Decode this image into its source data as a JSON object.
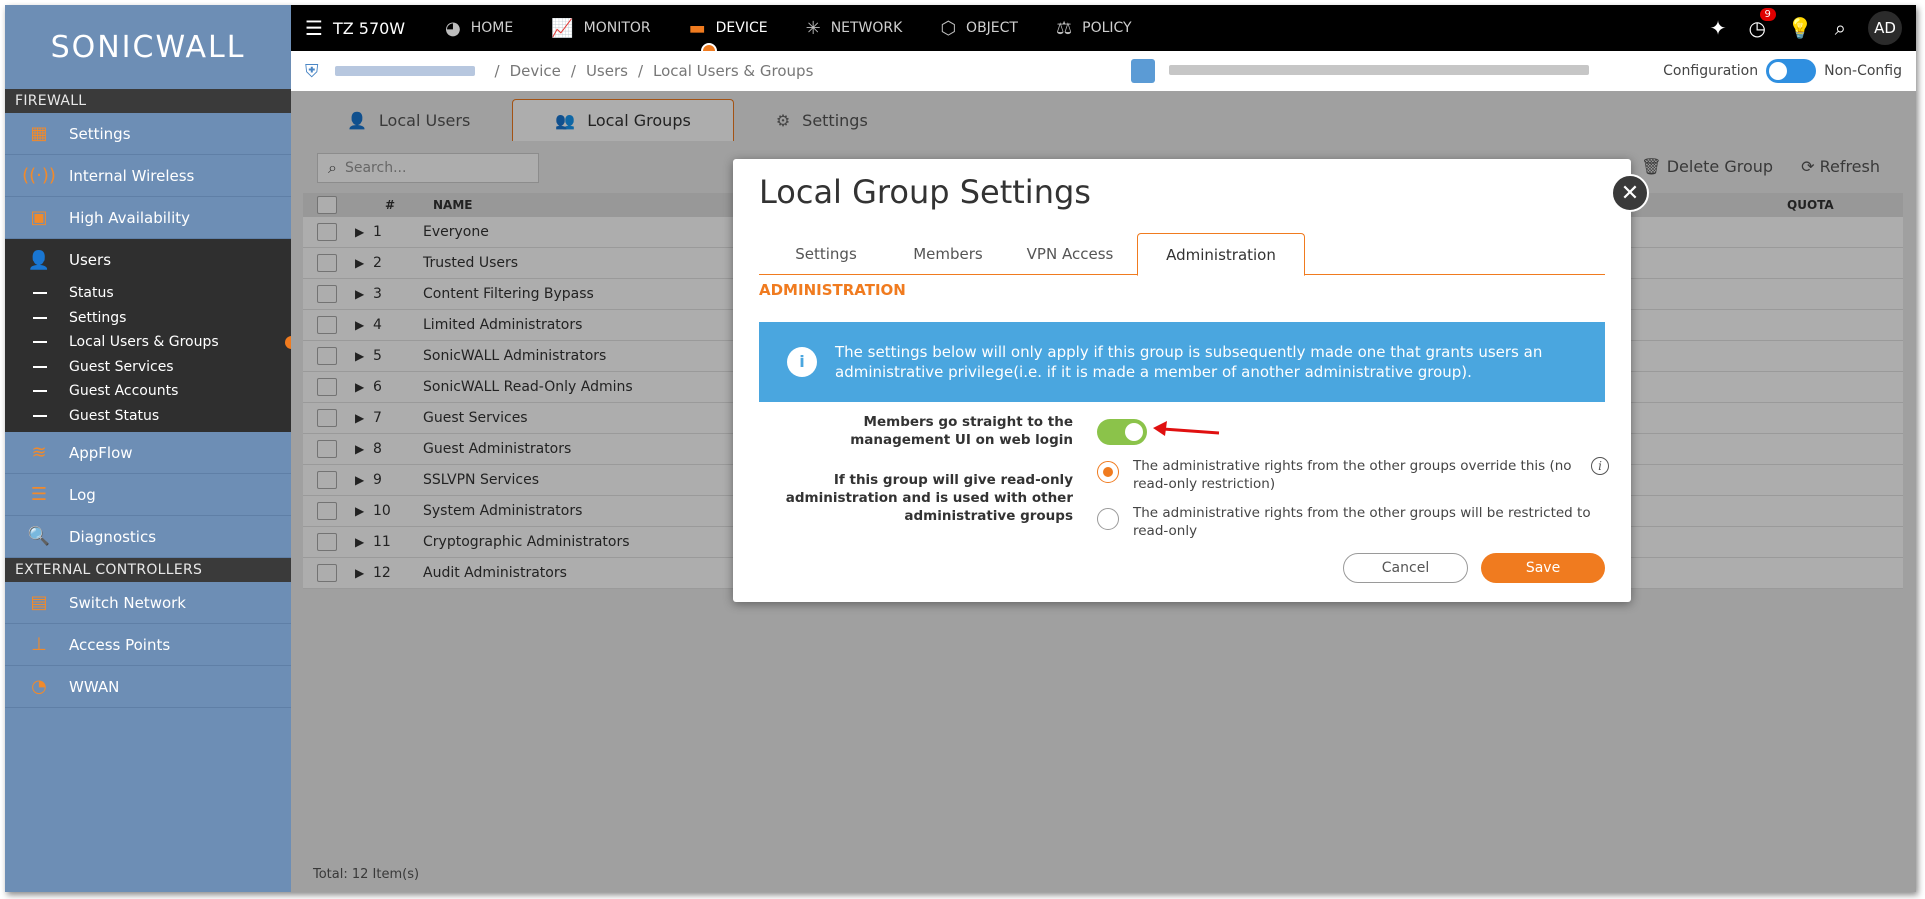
{
  "brand": {
    "logo_text": "SONICWALL"
  },
  "sidebar": {
    "sections": [
      {
        "title": "FIREWALL"
      },
      {
        "title": "EXTERNAL CONTROLLERS"
      }
    ],
    "items": [
      {
        "label": "Settings"
      },
      {
        "label": "Internal Wireless"
      },
      {
        "label": "High Availability"
      },
      {
        "label": "Users"
      },
      {
        "label": "AppFlow"
      },
      {
        "label": "Log"
      },
      {
        "label": "Diagnostics"
      },
      {
        "label": "Switch Network"
      },
      {
        "label": "Access Points"
      },
      {
        "label": "WWAN"
      }
    ],
    "users_sub": [
      {
        "label": "Status"
      },
      {
        "label": "Settings"
      },
      {
        "label": "Local Users & Groups"
      },
      {
        "label": "Guest Services"
      },
      {
        "label": "Guest Accounts"
      },
      {
        "label": "Guest Status"
      }
    ]
  },
  "topbar": {
    "model": "TZ 570W",
    "nav": [
      {
        "label": "HOME"
      },
      {
        "label": "MONITOR"
      },
      {
        "label": "DEVICE"
      },
      {
        "label": "NETWORK"
      },
      {
        "label": "OBJECT"
      },
      {
        "label": "POLICY"
      }
    ],
    "notification_count": "9",
    "avatar": "AD"
  },
  "breadcrumb": {
    "parts": [
      "Device",
      "Users",
      "Local Users & Groups"
    ],
    "sep": "/",
    "config_label": "Configuration",
    "nonconfig_label": "Non-Config"
  },
  "main": {
    "tabs": [
      {
        "label": "Local Users"
      },
      {
        "label": "Local Groups"
      },
      {
        "label": "Settings"
      }
    ],
    "search_placeholder": "Search...",
    "actions": {
      "delete": "Delete Group",
      "refresh": "Refresh"
    },
    "columns": {
      "num": "#",
      "name": "NAME",
      "quota": "QUOTA"
    },
    "rows": [
      {
        "n": "1",
        "name": "Everyone"
      },
      {
        "n": "2",
        "name": "Trusted Users"
      },
      {
        "n": "3",
        "name": "Content Filtering Bypass"
      },
      {
        "n": "4",
        "name": "Limited Administrators"
      },
      {
        "n": "5",
        "name": "SonicWALL Administrators"
      },
      {
        "n": "6",
        "name": "SonicWALL Read-Only Admins"
      },
      {
        "n": "7",
        "name": "Guest Services"
      },
      {
        "n": "8",
        "name": "Guest Administrators"
      },
      {
        "n": "9",
        "name": "SSLVPN Services"
      },
      {
        "n": "10",
        "name": "System Administrators"
      },
      {
        "n": "11",
        "name": "Cryptographic Administrators"
      },
      {
        "n": "12",
        "name": "Audit Administrators"
      }
    ],
    "footer": "Total: 12 Item(s)"
  },
  "modal": {
    "title": "Local Group Settings",
    "tabs": [
      {
        "label": "Settings"
      },
      {
        "label": "Members"
      },
      {
        "label": "VPN Access"
      },
      {
        "label": "Administration"
      }
    ],
    "section_title": "ADMINISTRATION",
    "info_text": "The settings below will only apply if this group is subsequently made one that grants users an administrative privilege(i.e. if it is made a member of another administrative group).",
    "members_label": "Members go straight to the management UI on web login",
    "readonly_label": "If this group will give read-only administration and is used with other administrative groups",
    "option1": "The administrative rights from the other groups override this (no read-only restriction)",
    "option2": "The administrative rights from the other groups will be restricted to read-only",
    "cancel": "Cancel",
    "save": "Save"
  },
  "colors": {
    "accent": "#f07b1f",
    "sidebar": "#6d8eb5",
    "info": "#4aa6df",
    "toggle_on": "#8bc34a"
  }
}
